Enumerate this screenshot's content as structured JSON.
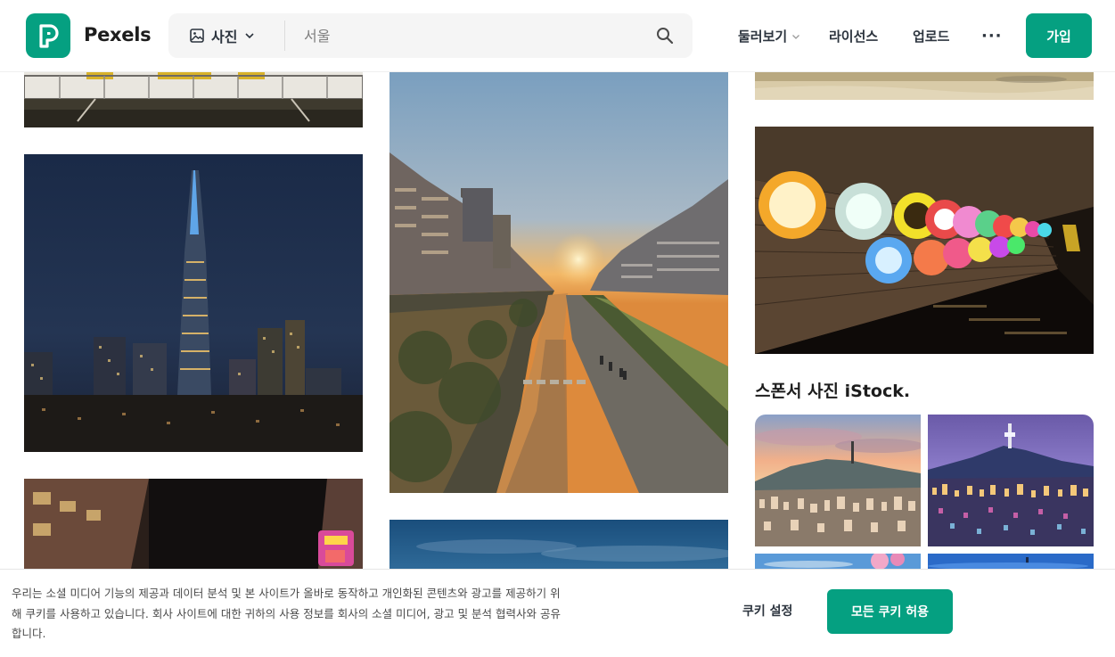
{
  "header": {
    "logo_text": "Pexels",
    "search_type": "사진",
    "search_placeholder": "서울",
    "nav": {
      "explore": "둘러보기",
      "license": "라이선스",
      "upload": "업로드",
      "more": "···"
    },
    "join_button": "가입"
  },
  "sponsored": {
    "title": "스폰서 사진",
    "brand": "iStock."
  },
  "cookie_banner": {
    "text": "우리는 소셜 미디어 기능의 제공과 데이터 분석 및 본 사이트가 올바로 동작하고 개인화된 콘텐츠와 광고를 제공하기 위해 쿠키를 사용하고 있습니다. 회사 사이트에 대한 귀하의 사용 정보를 회사의 소셜 미디어, 광고 및 분석 협력사와 공유합니다.",
    "settings_button": "쿠키 설정",
    "accept_button": "모든 쿠키 허용"
  },
  "colors": {
    "brand": "#05a081"
  }
}
